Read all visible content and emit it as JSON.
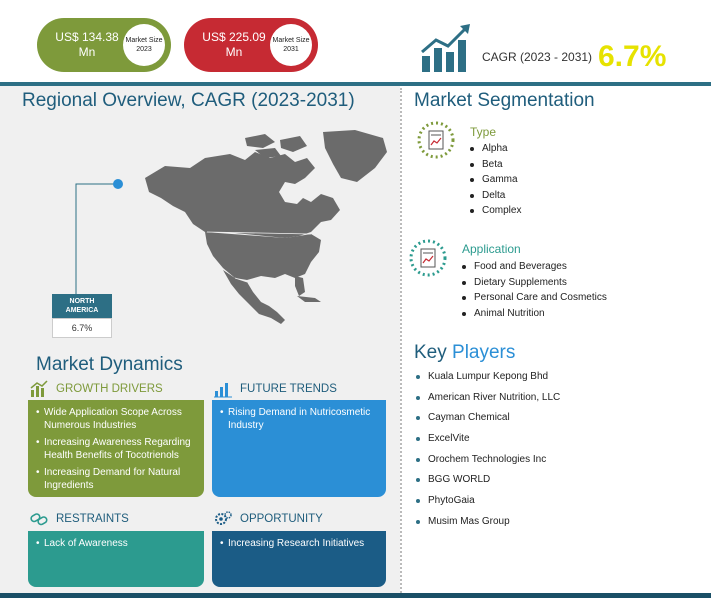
{
  "header": {
    "market_2023": {
      "value": "US$ 134.38 Mn",
      "label": "Market Size 2023"
    },
    "market_2031": {
      "value": "US$ 225.09 Mn",
      "label": "Market Size 2031"
    },
    "cagr_label": "CAGR (2023 - 2031)",
    "cagr_value": "6.7%"
  },
  "regional": {
    "title": "Regional Overview, CAGR (2023-2031)",
    "region_name": "NORTH AMERICA",
    "region_cagr": "6.7%"
  },
  "dynamics": {
    "title": "Market Dynamics",
    "growth_drivers": {
      "title": "GROWTH DRIVERS",
      "items": [
        "Wide Application Scope Across Numerous Industries",
        "Increasing Awareness Regarding Health Benefits of Tocotrienols",
        "Increasing Demand for Natural Ingredients"
      ]
    },
    "future_trends": {
      "title": "FUTURE TRENDS",
      "items": [
        "Rising Demand in Nutricosmetic Industry"
      ]
    },
    "restraints": {
      "title": "RESTRAINTS",
      "items": [
        "Lack of Awareness"
      ]
    },
    "opportunity": {
      "title": "OPPORTUNITY",
      "items": [
        "Increasing Research Initiatives"
      ]
    }
  },
  "segmentation": {
    "title": "Market Segmentation",
    "type": {
      "title": "Type",
      "items": [
        "Alpha",
        "Beta",
        "Gamma",
        "Delta",
        "Complex"
      ]
    },
    "application": {
      "title": "Application",
      "items": [
        "Food and Beverages",
        "Dietary Supplements",
        "Personal Care and Cosmetics",
        "Animal Nutrition"
      ]
    }
  },
  "key_players": {
    "title_bold": "Key",
    "title_rest": "Players",
    "items": [
      "Kuala Lumpur Kepong Bhd",
      "American River Nutrition, LLC",
      "Cayman Chemical",
      "ExcelVite",
      "Orochem Technologies Inc",
      "BGG WORLD",
      "PhytoGaia",
      "Musim Mas Group"
    ]
  },
  "colors": {
    "green": "#7e9a3b",
    "red": "#c62a33",
    "teal_dark": "#2d6f85",
    "yellow": "#e6e200",
    "blue": "#2b8fd6",
    "teal": "#2c9b8f",
    "navy": "#1b5c86"
  },
  "icons": {
    "cagr": "growth-chart-icon",
    "growth_drivers": "bar-chart-icon",
    "future_trends": "trend-bars-icon",
    "restraints": "chain-link-icon",
    "opportunity": "gears-icon",
    "type": "document-chart-icon",
    "application": "document-chart-icon"
  }
}
